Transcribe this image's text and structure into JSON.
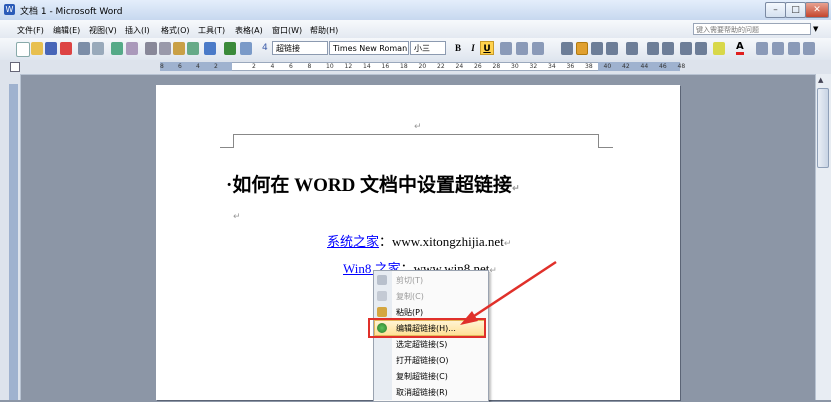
{
  "window": {
    "title": "文档 1 - Microsoft Word",
    "app_icon": "W"
  },
  "window_buttons": {
    "minimize": "–",
    "maximize": "□",
    "close": "✕"
  },
  "menu": [
    "文件(F)",
    "编辑(E)",
    "视图(V)",
    "插入(I)",
    "格式(O)",
    "工具(T)",
    "表格(A)",
    "窗口(W)",
    "帮助(H)"
  ],
  "help": {
    "placeholder": "键入需要帮助的问题"
  },
  "toolbar": {
    "style": "超链接",
    "font": "Times New Roman",
    "size": "小三",
    "bold": "B",
    "italic": "I",
    "underline": "U",
    "font_color_letter": "A"
  },
  "ruler": {
    "left_numbers": [
      "8",
      "6",
      "4",
      "2"
    ],
    "right_numbers": [
      "2",
      "4",
      "6",
      "8",
      "10",
      "12",
      "14",
      "16",
      "18",
      "20",
      "22",
      "24",
      "26",
      "28",
      "30",
      "32",
      "34",
      "36",
      "38",
      "40",
      "42",
      "44",
      "46",
      "48"
    ]
  },
  "document": {
    "header_mark": "↵",
    "heading": "·如何在 WORD 文档中设置超链接",
    "para_mark": "↵",
    "blank_line_mark": "↵",
    "line1_link": "系统之家",
    "line1_rest": "：www.xitongzhijia.net",
    "line2_link": "Win8 之家",
    "line2_rest": "：www.win8.net"
  },
  "context_menu": {
    "items": [
      {
        "label": "剪切(T)",
        "disabled": true,
        "icon": "scissors-icon"
      },
      {
        "label": "复制(C)",
        "disabled": true,
        "icon": "copy-icon"
      },
      {
        "label": "粘贴(P)",
        "disabled": false,
        "icon": "paste-icon"
      },
      {
        "label": "编辑超链接(H)...",
        "disabled": false,
        "icon": "hyperlink-icon",
        "highlighted": true
      },
      {
        "label": "选定超链接(S)",
        "disabled": false
      },
      {
        "label": "打开超链接(O)",
        "disabled": false
      },
      {
        "label": "复制超链接(C)",
        "disabled": false
      },
      {
        "label": "取消超链接(R)",
        "disabled": false
      }
    ]
  },
  "colors": {
    "link": "#0000ff",
    "annotation": "#e0302a",
    "highlight": "#ffe197"
  }
}
